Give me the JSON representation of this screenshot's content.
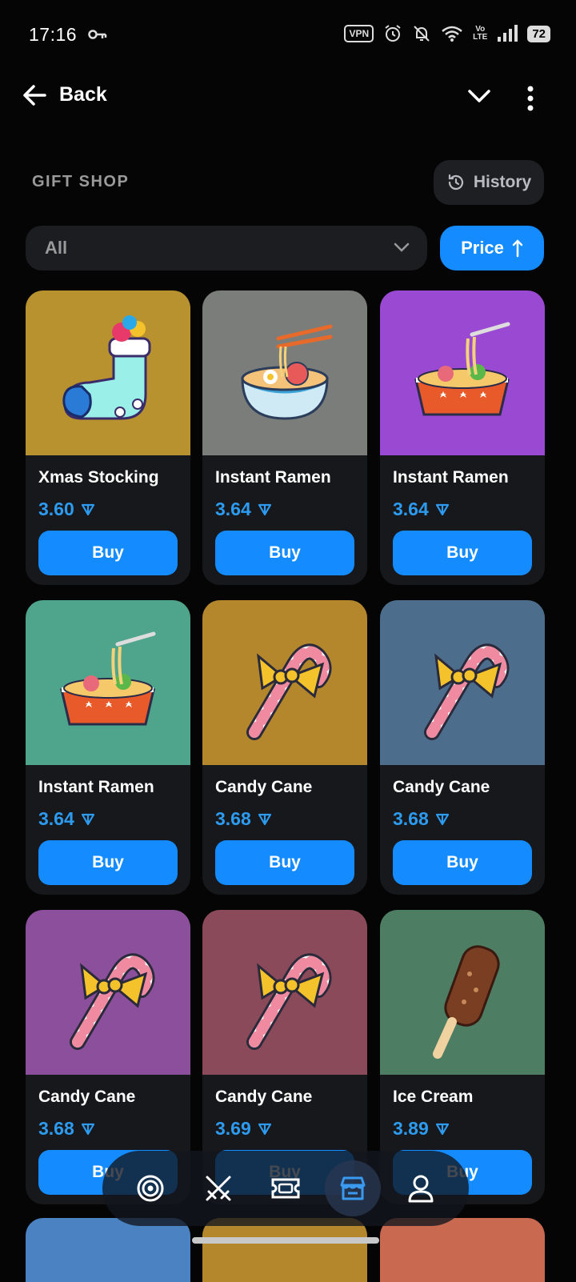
{
  "status_bar": {
    "time": "17:16",
    "vpn": "VPN",
    "volte_top": "Vo",
    "volte_bottom": "LTE",
    "battery": "72"
  },
  "top_bar": {
    "back_label": "Back"
  },
  "header": {
    "title": "GIFT SHOP",
    "history_label": "History"
  },
  "filter": {
    "selected": "All",
    "sort_label": "Price"
  },
  "colors": {
    "accent": "#148cff",
    "price": "#2d9bf0",
    "card_bg": "#17181b"
  },
  "items": [
    {
      "name": "Xmas Stocking",
      "price": "3.60",
      "buy_label": "Buy",
      "bg": "#b8922e",
      "icon": "stocking"
    },
    {
      "name": "Instant Ramen",
      "price": "3.64",
      "buy_label": "Buy",
      "bg": "#7b7d7a",
      "icon": "ramen-bowl"
    },
    {
      "name": "Instant Ramen",
      "price": "3.64",
      "buy_label": "Buy",
      "bg": "#9a4ad2",
      "icon": "ramen-tray"
    },
    {
      "name": "Instant Ramen",
      "price": "3.64",
      "buy_label": "Buy",
      "bg": "#4fa58c",
      "icon": "ramen-tray"
    },
    {
      "name": "Candy Cane",
      "price": "3.68",
      "buy_label": "Buy",
      "bg": "#b5872d",
      "icon": "candy-cane"
    },
    {
      "name": "Candy Cane",
      "price": "3.68",
      "buy_label": "Buy",
      "bg": "#4d6d8c",
      "icon": "candy-cane"
    },
    {
      "name": "Candy Cane",
      "price": "3.68",
      "buy_label": "Buy",
      "bg": "#8b4f9c",
      "icon": "candy-cane"
    },
    {
      "name": "Candy Cane",
      "price": "3.69",
      "buy_label": "Buy",
      "bg": "#8a4a5a",
      "icon": "candy-cane"
    },
    {
      "name": "Ice Cream",
      "price": "3.89",
      "buy_label": "Buy",
      "bg": "#4d7d62",
      "icon": "ice-cream"
    }
  ],
  "bottom_nav": [
    {
      "icon": "target-icon"
    },
    {
      "icon": "swords-icon"
    },
    {
      "icon": "ticket-icon"
    },
    {
      "icon": "store-icon",
      "active": true
    },
    {
      "icon": "profile-icon"
    }
  ]
}
